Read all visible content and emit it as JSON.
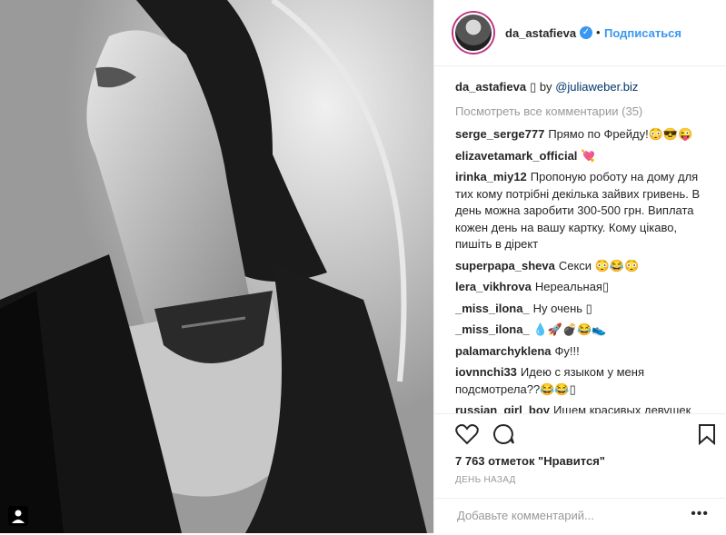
{
  "header": {
    "username": "da_astafieva",
    "verified_icon": "verified-badge-icon",
    "separator": "•",
    "follow_label": "Подписаться"
  },
  "caption": {
    "username": "da_astafieva",
    "text": "▯ by",
    "link": "@juliaweber.biz"
  },
  "view_all": "Посмотреть все комментарии (35)",
  "comments": [
    {
      "user": "serge_serge777",
      "text": "Прямо по Фрейду!😳😎😜"
    },
    {
      "user": "elizavetamark_official",
      "text": "💘"
    },
    {
      "user": "irinka_miy12",
      "text": "Пропоную роботу на дому для тих кому потрібні декілька зайвих гривень. В день можна заробити 300-500 грн. Виплата кожен день на вашу картку. Кому цікаво, пишіть в дірект"
    },
    {
      "user": "superpapa_sheva",
      "text": "Секси 😳😂😳"
    },
    {
      "user": "lera_vikhrova",
      "text": "Нереальная▯"
    },
    {
      "user": "_miss_ilona_",
      "text": "Ну очень ▯"
    },
    {
      "user": "_miss_ilona_",
      "text": "💧🚀💣😂👟"
    },
    {
      "user": "palamarchyklena",
      "text": "Фу!!!"
    },
    {
      "user": "iovnnchi33",
      "text": "Идею с языком у меня подсмотрела??😂😂▯"
    },
    {
      "user": "russian_girl_boy",
      "text": "Ищем красивых девушек"
    }
  ],
  "actions": {
    "like_icon": "heart-icon",
    "comment_icon": "comment-icon",
    "save_icon": "bookmark-icon"
  },
  "likes": "7 763 отметок \"Нравится\"",
  "time": "ДЕНЬ НАЗАД",
  "add_comment": {
    "placeholder": "Добавьте комментарий...",
    "more": "•••"
  },
  "photo": {
    "description_icon": "tag-icon"
  }
}
